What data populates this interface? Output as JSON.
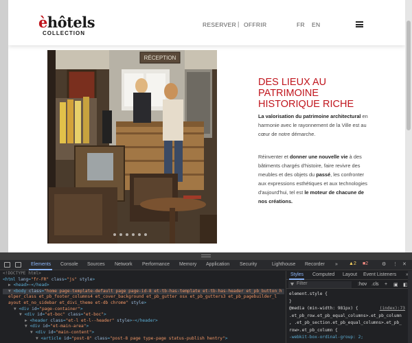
{
  "site": {
    "logo": {
      "main": "èhôtels",
      "sub": "COLLECTION"
    },
    "nav": {
      "reserver": "RESERVER",
      "separator": "|",
      "offrir": "OFFRIR",
      "lang_fr": "FR",
      "lang_en": "EN"
    },
    "photo": {
      "sign": "RÉCEPTION"
    },
    "title": "DES LIEUX AU PATRIMOINE HISTORIQUE RICHE",
    "para1": [
      {
        "text": "La valorisation du patrimoine architectural",
        "bold": true
      },
      {
        "text": " en harmonie avec le rayonnement de la Ville est au cœur de notre démarche.",
        "bold": false
      }
    ],
    "para2": [
      {
        "text": "Réinventer et ",
        "bold": false
      },
      {
        "text": "donner une nouvelle vie",
        "bold": true
      },
      {
        "text": " à des bâtiments chargés d'histoire, faire revivre des meubles et des objets du ",
        "bold": false
      },
      {
        "text": "passé",
        "bold": true
      },
      {
        "text": ", les confronter aux expressions esthétiques et aux technologies d'aujourd'hui, tel est ",
        "bold": false
      },
      {
        "text": "le moteur de chacune de nos créations.",
        "bold": true
      }
    ],
    "colors": {
      "accent": "#c0141c"
    }
  },
  "devtools": {
    "tabs": [
      "Elements",
      "Console",
      "Sources",
      "Network",
      "Performance",
      "Memory",
      "Application",
      "Security",
      "Lighthouse",
      "Recorder"
    ],
    "active_tab": "Elements",
    "more": "»",
    "warnings": "2",
    "issues": "2",
    "dom_lines": [
      {
        "indent": 0,
        "segs": [
          [
            "c",
            "<!DOCTYPE html>"
          ]
        ]
      },
      {
        "indent": 0,
        "segs": [
          [
            "t",
            "<html "
          ],
          [
            "a",
            "lang"
          ],
          [
            "t",
            "="
          ],
          [
            "v",
            "\"fr-FR\""
          ],
          [
            "a",
            " class"
          ],
          [
            "t",
            "="
          ],
          [
            "v",
            "\"js\""
          ],
          [
            "a",
            " style"
          ],
          [
            "t",
            ">"
          ]
        ]
      },
      {
        "indent": 1,
        "segs": [
          [
            "c",
            "▶ "
          ],
          [
            "t",
            "<head>"
          ],
          [
            "c",
            "⋯"
          ],
          [
            "t",
            "</head>"
          ]
        ]
      },
      {
        "indent": 1,
        "segs": [
          [
            "c",
            "▼ "
          ],
          [
            "t",
            "<body "
          ],
          [
            "a",
            "class"
          ],
          [
            "t",
            "="
          ],
          [
            "v",
            "\"home page-template-default page page-id-8 et-tb-has-template et-tb-has-header et_pb_button_h"
          ]
        ]
      },
      {
        "indent": 1,
        "segs": [
          [
            "v",
            "elper_class et_pb_footer_columns4 et_cover_background et_pb_gutter osx et_pb_gutters3 et_pb_pagebuilder_l"
          ]
        ]
      },
      {
        "indent": 1,
        "segs": [
          [
            "v",
            "ayout et_no_sidebar et_divi_theme et-db chrome\""
          ],
          [
            "a",
            " style"
          ],
          [
            "t",
            ">"
          ]
        ]
      },
      {
        "indent": 2,
        "segs": [
          [
            "c",
            "▼ "
          ],
          [
            "t",
            "<div "
          ],
          [
            "a",
            "id"
          ],
          [
            "t",
            "="
          ],
          [
            "v",
            "\"page-container\""
          ],
          [
            "t",
            ">"
          ]
        ]
      },
      {
        "indent": 3,
        "segs": [
          [
            "c",
            "▼ "
          ],
          [
            "t",
            "<div "
          ],
          [
            "a",
            "id"
          ],
          [
            "t",
            "="
          ],
          [
            "v",
            "\"et-boc\""
          ],
          [
            "a",
            " class"
          ],
          [
            "t",
            "="
          ],
          [
            "v",
            "\"et-boc\""
          ],
          [
            "t",
            ">"
          ]
        ]
      },
      {
        "indent": 4,
        "segs": [
          [
            "c",
            "▶ "
          ],
          [
            "t",
            "<header "
          ],
          [
            "a",
            "class"
          ],
          [
            "t",
            "="
          ],
          [
            "v",
            "\"et-l et-l--header\""
          ],
          [
            "a",
            " style"
          ],
          [
            "t",
            ">"
          ],
          [
            "c",
            "⋯"
          ],
          [
            "t",
            "</header>"
          ]
        ]
      },
      {
        "indent": 4,
        "segs": [
          [
            "c",
            "▼ "
          ],
          [
            "t",
            "<div "
          ],
          [
            "a",
            "id"
          ],
          [
            "t",
            "="
          ],
          [
            "v",
            "\"et-main-area\""
          ],
          [
            "t",
            ">"
          ]
        ]
      },
      {
        "indent": 5,
        "segs": [
          [
            "c",
            "▼ "
          ],
          [
            "t",
            "<div "
          ],
          [
            "a",
            "id"
          ],
          [
            "t",
            "="
          ],
          [
            "v",
            "\"main-content\""
          ],
          [
            "t",
            ">"
          ]
        ]
      },
      {
        "indent": 6,
        "segs": [
          [
            "c",
            "▼ "
          ],
          [
            "t",
            "<article "
          ],
          [
            "a",
            "id"
          ],
          [
            "t",
            "="
          ],
          [
            "v",
            "\"post-8\""
          ],
          [
            "a",
            " class"
          ],
          [
            "t",
            "="
          ],
          [
            "v",
            "\"post-8 page type-page status-publish hentry\""
          ],
          [
            "t",
            ">"
          ]
        ]
      }
    ],
    "styles": {
      "tabs": [
        "Styles",
        "Computed",
        "Layout",
        "Event Listeners"
      ],
      "more": "»",
      "filter_placeholder": "Filter",
      "hov": ":hov",
      "cls": ".cls",
      "plus": "+",
      "rules": [
        {
          "text": "element.style {"
        },
        {
          "text": "}"
        },
        {
          "text": "@media (min-width: 981px) {",
          "link": "(index):73"
        },
        {
          "text": ".et_pb_row.et_pb_equal_columns>.et_pb_column"
        },
        {
          "text": ", .et_pb_section.et_pb_equal_columns>.et_pb_"
        },
        {
          "text": "row>.et_pb_column {"
        },
        {
          "text": "  -webkit-box-ordinal-group: 2;",
          "prop": true
        }
      ]
    }
  }
}
